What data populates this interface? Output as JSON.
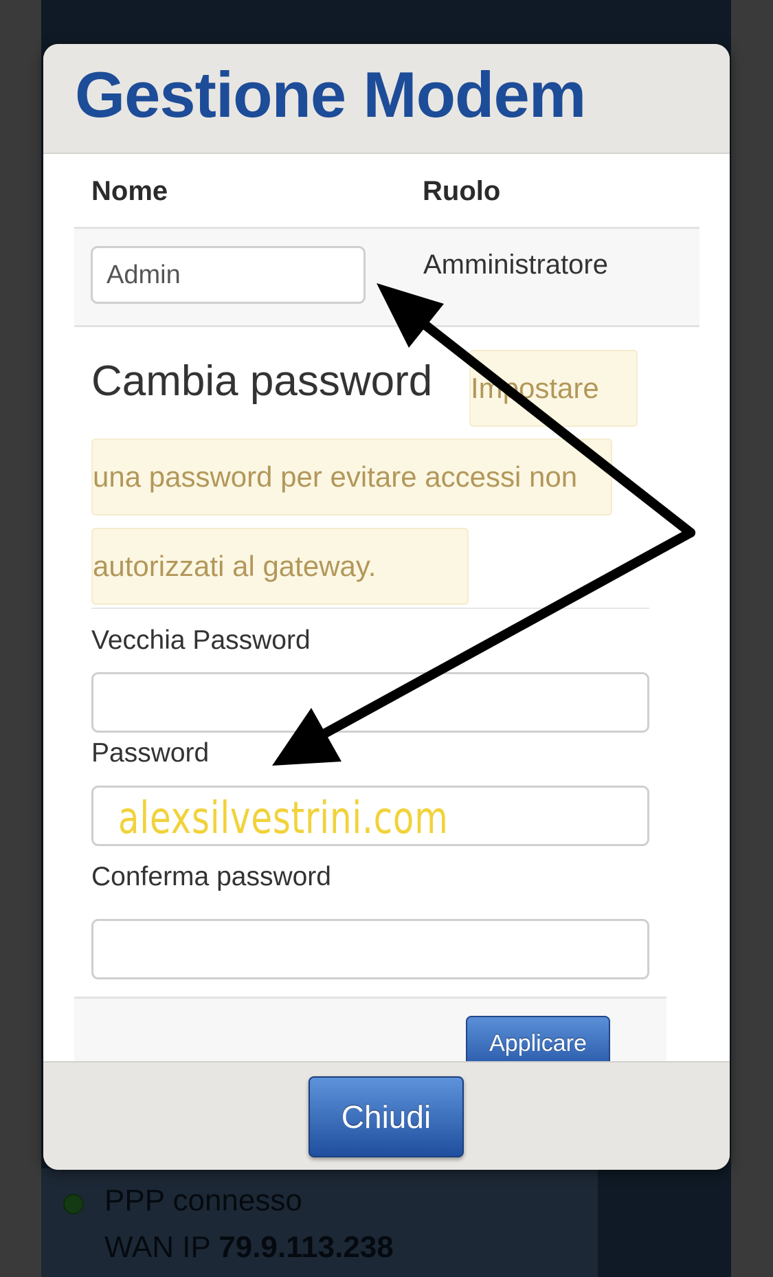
{
  "background": {
    "status_text": "PPP connesso",
    "wan_label": "WAN IP",
    "wan_ip": "79.9.113.238"
  },
  "modal": {
    "title": "Gestione Modem",
    "columns": {
      "name": "Nome",
      "role": "Ruolo"
    },
    "row": {
      "name_value": "Admin",
      "role": "Amministratore"
    },
    "section_title": "Cambia password",
    "warning_lines": [
      "Impostare",
      "una password per evitare accessi non",
      "autorizzati al gateway."
    ],
    "fields": {
      "old_password_label": "Vecchia Password",
      "password_label": "Password",
      "confirm_label": "Conferma password"
    },
    "apply_label": "Applicare",
    "close_label": "Chiudi"
  },
  "watermark": "alexsilvestrini.com",
  "colors": {
    "title_blue": "#1d4c98",
    "warning_bg": "#fbf7e3",
    "warning_text": "#b3975a",
    "button_blue": "#2758a8",
    "watermark_yellow": "#f2d23a"
  }
}
